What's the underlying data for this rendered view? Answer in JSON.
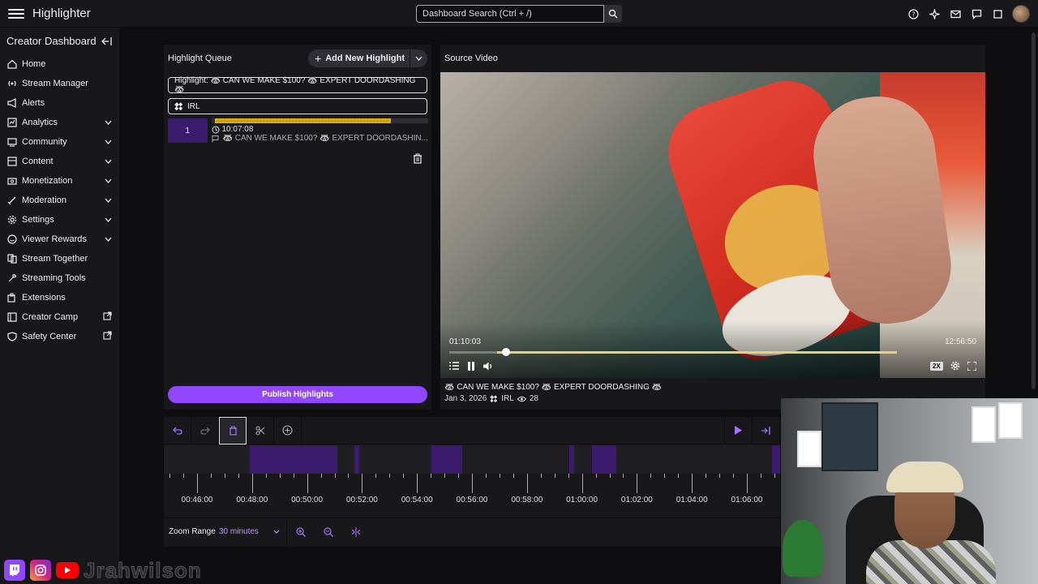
{
  "topbar": {
    "app_title": "Highlighter",
    "search_placeholder": "Dashboard Search (Ctrl + /)"
  },
  "sidebar": {
    "title": "Creator Dashboard",
    "items": [
      {
        "label": "Home",
        "icon": "home-icon",
        "expandable": false,
        "external": false
      },
      {
        "label": "Stream Manager",
        "icon": "broadcast-icon",
        "expandable": false,
        "external": false
      },
      {
        "label": "Alerts",
        "icon": "megaphone-icon",
        "expandable": false,
        "external": false
      },
      {
        "label": "Analytics",
        "icon": "analytics-icon",
        "expandable": true,
        "external": false
      },
      {
        "label": "Community",
        "icon": "community-icon",
        "expandable": true,
        "external": false
      },
      {
        "label": "Content",
        "icon": "content-icon",
        "expandable": true,
        "external": false
      },
      {
        "label": "Monetization",
        "icon": "money-icon",
        "expandable": true,
        "external": false
      },
      {
        "label": "Moderation",
        "icon": "sword-icon",
        "expandable": true,
        "external": false
      },
      {
        "label": "Settings",
        "icon": "gear-icon",
        "expandable": true,
        "external": false
      },
      {
        "label": "Viewer Rewards",
        "icon": "rewards-icon",
        "expandable": true,
        "external": false
      },
      {
        "label": "Stream Together",
        "icon": "stream-together-icon",
        "expandable": false,
        "external": false
      },
      {
        "label": "Streaming Tools",
        "icon": "tools-icon",
        "expandable": false,
        "external": false
      },
      {
        "label": "Extensions",
        "icon": "extensions-icon",
        "expandable": false,
        "external": false
      },
      {
        "label": "Creator Camp",
        "icon": "book-icon",
        "expandable": false,
        "external": true
      },
      {
        "label": "Safety Center",
        "icon": "shield-icon",
        "expandable": false,
        "external": true
      }
    ]
  },
  "queue": {
    "title": "Highlight Queue",
    "add_label": "Add New Highlight",
    "title_field": "Highlight: 🦝 CAN WE MAKE $100? 🦝 EXPERT DOORDASHING 🦝",
    "category_field": "IRL",
    "items": [
      {
        "number": "1",
        "timestamp": "10:07:08",
        "description": "🦝 CAN WE MAKE $100? 🦝 EXPERT DOORDASHIN..."
      }
    ],
    "publish_label": "Publish Highlights"
  },
  "source": {
    "title": "Source Video",
    "current_time": "01:10:03",
    "duration": "12:56:50",
    "speed": "2X",
    "caption": "🦝 CAN WE MAKE $100? 🦝 EXPERT DOORDASHING 🦝",
    "date": "Jan 3, 2026",
    "category": "IRL",
    "views": "28"
  },
  "timeline": {
    "ticks": [
      "00:46:00",
      "00:48:00",
      "00:50:00",
      "00:52:00",
      "00:54:00",
      "00:56:00",
      "00:58:00",
      "01:00:00",
      "01:02:00",
      "01:04:00",
      "01:06:00"
    ],
    "zoom_label": "Zoom Range",
    "zoom_value": "30 minutes"
  },
  "branding": {
    "name": "Jrahwilson"
  },
  "colors": {
    "accent": "#9147ff",
    "background": "#0e0e10",
    "panel": "#18181b",
    "highlight_segment": "#3a1b6e"
  }
}
